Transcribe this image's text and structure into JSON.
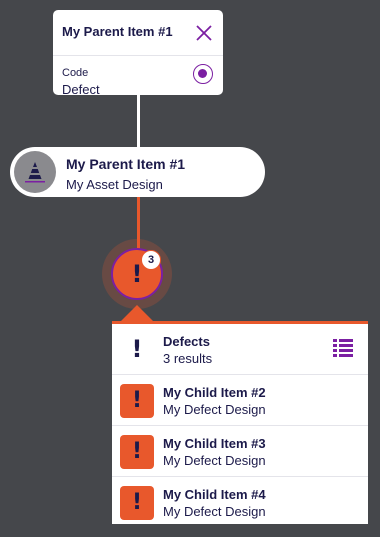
{
  "parent_card": {
    "title": "My Parent Item #1",
    "code_label": "Code",
    "code_value": "Defect"
  },
  "parent_node": {
    "title": "My Parent Item #1",
    "subtitle": "My Asset Design"
  },
  "defect_node": {
    "count": "3"
  },
  "defects_panel": {
    "title": "Defects",
    "results": "3 results",
    "items": [
      {
        "title": "My Child Item #2",
        "subtitle": "My Defect Design"
      },
      {
        "title": "My Child Item #3",
        "subtitle": "My Defect Design"
      },
      {
        "title": "My Child Item #4",
        "subtitle": "My Defect Design"
      }
    ]
  },
  "colors": {
    "background": "#45474b",
    "accent_orange": "#e8582c",
    "accent_purple": "#7b1fa2",
    "text_navy": "#1c1a4a"
  },
  "icons": {
    "close": "close-icon",
    "radio": "radio-selected-icon",
    "asset": "traffic-cone-icon",
    "defect": "exclamation-icon",
    "list": "list-view-icon"
  }
}
